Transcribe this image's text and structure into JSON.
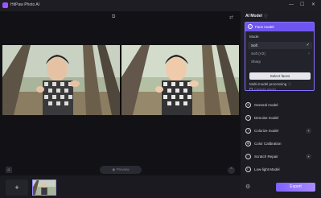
{
  "window": {
    "title": "HitPaw Photo AI",
    "minimize_glyph": "—",
    "maximize_glyph": "☐",
    "close_glyph": "✕"
  },
  "toolbar": {
    "compare_glyph": "⧉",
    "split_glyph": "⇄"
  },
  "bottom": {
    "home_glyph": "⌂",
    "preview_label": "Preview",
    "preview_glyph": "◉",
    "collapse_glyph": "⌃",
    "add_glyph": "+"
  },
  "panel": {
    "title": "AI Model",
    "title_info_glyph": "ⓘ",
    "face_model": {
      "label": "Face model",
      "mode_label": "Mode:",
      "options": [
        {
          "label": "Soft",
          "selected": true,
          "mark": "✓"
        },
        {
          "label": "Soft (V2)",
          "selected": false,
          "mark": "?"
        },
        {
          "label": "Sharp",
          "selected": false,
          "mark": ""
        }
      ],
      "select_faces_label": "Select faces",
      "multi_model_label": "Multi-model processing",
      "multi_model_info_glyph": "ⓘ",
      "colorize_option_label": "Colorize model"
    },
    "models": [
      {
        "label": "General model",
        "icon": "general-model-icon",
        "glyph": "◎",
        "badge": ""
      },
      {
        "label": "Denoise model",
        "icon": "denoise-model-icon",
        "glyph": "◐",
        "badge": ""
      },
      {
        "label": "Colorize model",
        "icon": "colorize-model-icon",
        "glyph": "◑",
        "badge": "✦"
      },
      {
        "label": "Color Calibration",
        "icon": "color-calibration-icon",
        "glyph": "◍",
        "badge": ""
      },
      {
        "label": "Scratch Repair",
        "icon": "scratch-repair-icon",
        "glyph": "◌",
        "badge": "✦"
      },
      {
        "label": "Low-light Model",
        "icon": "low-light-model-icon",
        "glyph": "☾",
        "badge": ""
      }
    ],
    "settings_glyph": "⚙",
    "export_label": "Export"
  },
  "colors": {
    "accent": "#7e62ff",
    "background": "#17171c",
    "panel": "#1c1c22"
  }
}
